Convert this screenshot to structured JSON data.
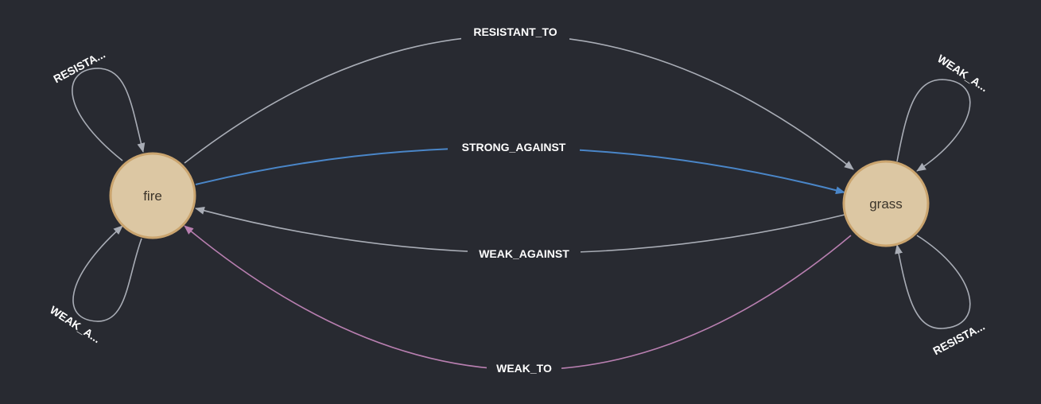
{
  "colors": {
    "background": "#282a31",
    "node_fill": "#dcc7a3",
    "node_stroke": "#caa46e",
    "edge_default": "#a9adb6",
    "edge_strong": "#4a86c8",
    "edge_weak_to": "#b87fb0",
    "label_text": "#ffffff"
  },
  "nodes": {
    "fire": {
      "label": "fire"
    },
    "grass": {
      "label": "grass"
    }
  },
  "edges": {
    "resistant_to": {
      "label": "RESISTANT_TO",
      "source": "fire",
      "target": "grass"
    },
    "strong_against": {
      "label": "STRONG_AGAINST",
      "source": "fire",
      "target": "grass"
    },
    "weak_against": {
      "label": "WEAK_AGAINST",
      "source": "grass",
      "target": "fire"
    },
    "weak_to": {
      "label": "WEAK_TO",
      "source": "grass",
      "target": "fire"
    },
    "fire_self_top": {
      "label": "RESISTA...",
      "source": "fire",
      "target": "fire"
    },
    "fire_self_bottom": {
      "label": "WEAK_A...",
      "source": "fire",
      "target": "fire"
    },
    "grass_self_top": {
      "label": "WEAK_A...",
      "source": "grass",
      "target": "grass"
    },
    "grass_self_bottom": {
      "label": "RESISTA...",
      "source": "grass",
      "target": "grass"
    }
  }
}
